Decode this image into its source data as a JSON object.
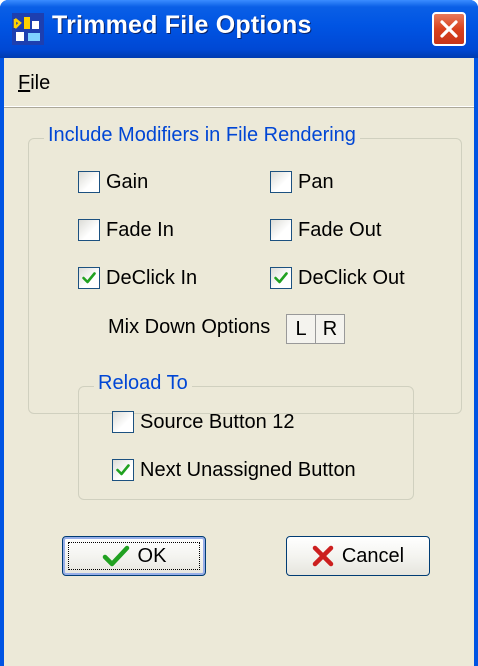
{
  "window": {
    "title": "Trimmed File Options",
    "close_label": "✕"
  },
  "menu": {
    "file_first": "F",
    "file_rest": "ile"
  },
  "modifiers": {
    "group_title": "Include Modifiers in File Rendering",
    "options": [
      {
        "label": "Gain",
        "checked": false
      },
      {
        "label": "Pan",
        "checked": false
      },
      {
        "label": "Fade In",
        "checked": false
      },
      {
        "label": "Fade Out",
        "checked": false
      },
      {
        "label": "DeClick In",
        "checked": true
      },
      {
        "label": "DeClick Out",
        "checked": true
      }
    ],
    "mix_down_label": "Mix Down Options",
    "mix_left": "L",
    "mix_right": "R"
  },
  "reload": {
    "group_title": "Reload To",
    "options": [
      {
        "label": "Source Button 12",
        "checked": false
      },
      {
        "label": "Next Unassigned Button",
        "checked": true
      }
    ]
  },
  "buttons": {
    "ok_label": "OK",
    "cancel_label": "Cancel"
  },
  "colors": {
    "titlebar": "#0054e3",
    "group_title": "#0046d5",
    "checkmark": "#21a121",
    "cancel_x": "#cc1f1f"
  }
}
